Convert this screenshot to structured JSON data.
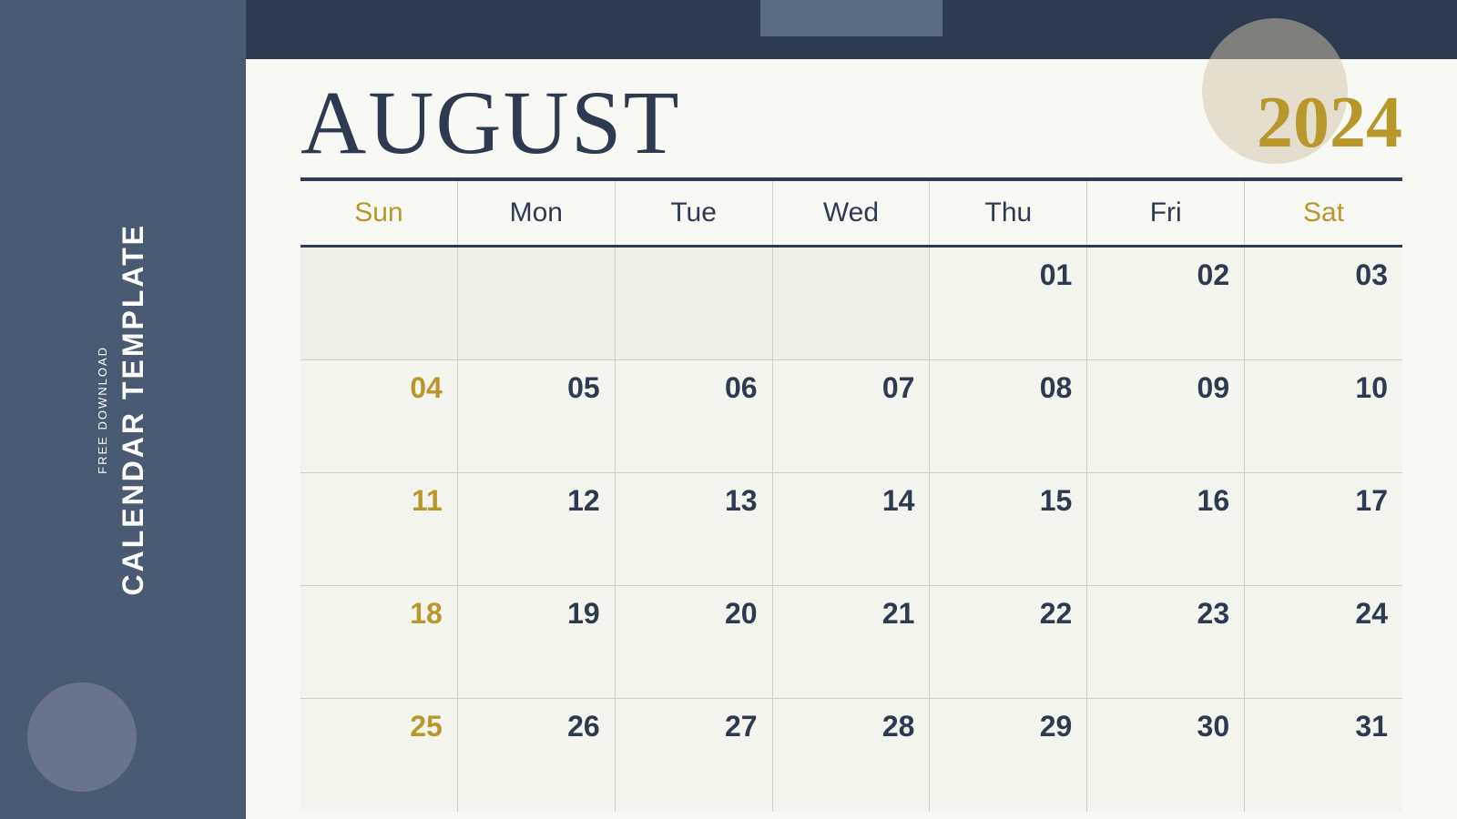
{
  "sidebar": {
    "free_download_label": "FREE DOWNLOAD",
    "calendar_template_label": "CALENDAR TEMPLATE"
  },
  "calendar": {
    "month": "AUGUST",
    "year": "2024",
    "day_headers": [
      {
        "label": "Sun",
        "type": "weekend"
      },
      {
        "label": "Mon",
        "type": "weekday"
      },
      {
        "label": "Tue",
        "type": "weekday"
      },
      {
        "label": "Wed",
        "type": "weekday"
      },
      {
        "label": "Thu",
        "type": "weekday"
      },
      {
        "label": "Fri",
        "type": "weekday"
      },
      {
        "label": "Sat",
        "type": "weekend"
      }
    ],
    "weeks": [
      [
        {
          "day": "",
          "empty": true,
          "type": "sunday"
        },
        {
          "day": "",
          "empty": true,
          "type": "weekday"
        },
        {
          "day": "",
          "empty": true,
          "type": "weekday"
        },
        {
          "day": "",
          "empty": true,
          "type": "weekday"
        },
        {
          "day": "01",
          "empty": false,
          "type": "weekday"
        },
        {
          "day": "02",
          "empty": false,
          "type": "weekday"
        },
        {
          "day": "03",
          "empty": false,
          "type": "saturday"
        }
      ],
      [
        {
          "day": "04",
          "empty": false,
          "type": "sunday"
        },
        {
          "day": "05",
          "empty": false,
          "type": "weekday"
        },
        {
          "day": "06",
          "empty": false,
          "type": "weekday"
        },
        {
          "day": "07",
          "empty": false,
          "type": "weekday"
        },
        {
          "day": "08",
          "empty": false,
          "type": "weekday"
        },
        {
          "day": "09",
          "empty": false,
          "type": "weekday"
        },
        {
          "day": "10",
          "empty": false,
          "type": "saturday"
        }
      ],
      [
        {
          "day": "11",
          "empty": false,
          "type": "sunday"
        },
        {
          "day": "12",
          "empty": false,
          "type": "weekday"
        },
        {
          "day": "13",
          "empty": false,
          "type": "weekday"
        },
        {
          "day": "14",
          "empty": false,
          "type": "weekday"
        },
        {
          "day": "15",
          "empty": false,
          "type": "weekday"
        },
        {
          "day": "16",
          "empty": false,
          "type": "weekday"
        },
        {
          "day": "17",
          "empty": false,
          "type": "saturday"
        }
      ],
      [
        {
          "day": "18",
          "empty": false,
          "type": "sunday"
        },
        {
          "day": "19",
          "empty": false,
          "type": "weekday"
        },
        {
          "day": "20",
          "empty": false,
          "type": "weekday"
        },
        {
          "day": "21",
          "empty": false,
          "type": "weekday"
        },
        {
          "day": "22",
          "empty": false,
          "type": "weekday"
        },
        {
          "day": "23",
          "empty": false,
          "type": "weekday"
        },
        {
          "day": "24",
          "empty": false,
          "type": "saturday"
        }
      ],
      [
        {
          "day": "25",
          "empty": false,
          "type": "sunday"
        },
        {
          "day": "26",
          "empty": false,
          "type": "weekday"
        },
        {
          "day": "27",
          "empty": false,
          "type": "weekday"
        },
        {
          "day": "28",
          "empty": false,
          "type": "weekday"
        },
        {
          "day": "29",
          "empty": false,
          "type": "weekday"
        },
        {
          "day": "30",
          "empty": false,
          "type": "weekday"
        },
        {
          "day": "31",
          "empty": false,
          "type": "saturday"
        }
      ]
    ]
  }
}
